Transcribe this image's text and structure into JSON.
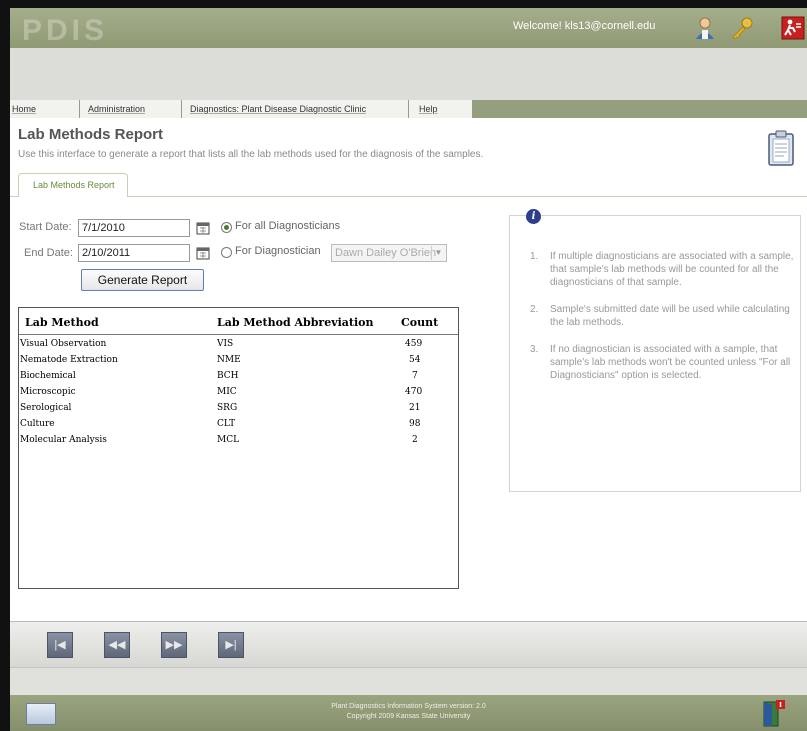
{
  "header": {
    "logo_text": "PDIS",
    "welcome": "Welcome! kls13@cornell.edu",
    "icons": [
      "user-icon",
      "keys-icon",
      "logout-icon"
    ]
  },
  "nav": {
    "items": [
      {
        "label": "Home"
      },
      {
        "label": "Administration"
      },
      {
        "label": "Diagnostics: Plant Disease Diagnostic Clinic"
      },
      {
        "label": "Help"
      }
    ]
  },
  "page": {
    "title": "Lab Methods Report",
    "description": "Use this interface to generate a report that lists all the lab methods used for the diagnosis of the samples.",
    "tab_label": "Lab Methods Report"
  },
  "form": {
    "start_label": "Start Date:",
    "start_value": "7/1/2010",
    "end_label": "End Date:",
    "end_value": "2/10/2011",
    "radio_all": "For all Diagnosticians",
    "radio_all_selected": true,
    "radio_one": "For Diagnostician",
    "diagnostician_select": "Dawn Dailey O'Brien",
    "generate_label": "Generate Report"
  },
  "table": {
    "headers": [
      "Lab Method",
      "Lab Method Abbreviation",
      "Count"
    ],
    "rows": [
      {
        "method": "Visual Observation",
        "abbr": "VIS",
        "count": "459"
      },
      {
        "method": "Nematode Extraction",
        "abbr": "NME",
        "count": "54"
      },
      {
        "method": "Biochemical",
        "abbr": "BCH",
        "count": "7"
      },
      {
        "method": "Microscopic",
        "abbr": "MIC",
        "count": "470"
      },
      {
        "method": "Serological",
        "abbr": "SRG",
        "count": "21"
      },
      {
        "method": "Culture",
        "abbr": "CLT",
        "count": "98"
      },
      {
        "method": "Molecular Analysis",
        "abbr": "MCL",
        "count": "2"
      }
    ]
  },
  "info": {
    "icon_text": "i",
    "notes": [
      {
        "num": "1.",
        "text": "If multiple diagnosticians are associated with a sample, that sample's lab methods will be counted for all the diagnosticians of that sample."
      },
      {
        "num": "2.",
        "text": "Sample's submitted date will be used while calculating the lab methods."
      },
      {
        "num": "3.",
        "text": "If no diagnostician is associated with a sample, that sample's lab methods won't be counted unless \"For all Diagnosticians\" option is selected."
      }
    ]
  },
  "pager": {
    "buttons": [
      {
        "name": "first-page-button",
        "glyph": "|◀"
      },
      {
        "name": "previous-page-button",
        "glyph": "◀◀"
      },
      {
        "name": "next-page-button",
        "glyph": "▶▶"
      },
      {
        "name": "last-page-button",
        "glyph": "▶|"
      }
    ]
  },
  "footer": {
    "version": "Plant Diagnostics Information System version: 2.0",
    "copyright": "Copyright 2009 Kansas State University"
  },
  "colors": {
    "header_green": "#959e7d",
    "tab_text_green": "#6d8a3a",
    "info_blue": "#2c3f8c",
    "logout_red": "#c8201e"
  }
}
